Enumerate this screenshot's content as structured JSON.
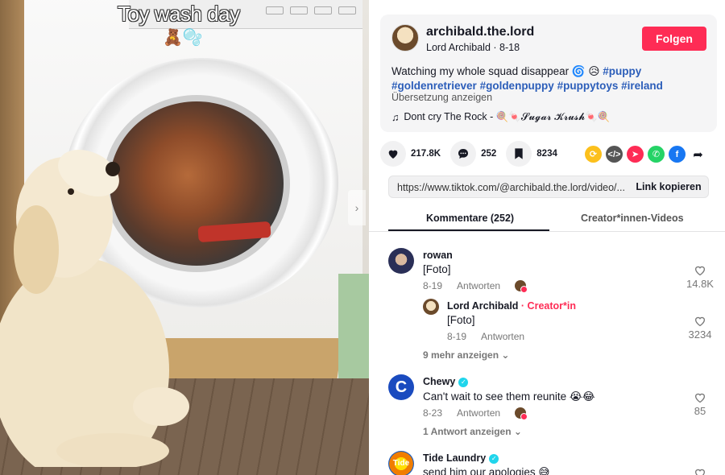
{
  "video": {
    "caption": "Toy wash day",
    "caption_emoji": "🧸🫧"
  },
  "post": {
    "username": "archibald.the.lord",
    "nickname_date": "Lord Archibald · 8-18",
    "follow_label": "Folgen",
    "description_text": "Watching my whole squad disappear 🌀 😥",
    "hashtags": [
      "#puppy",
      "#goldenretriever",
      "#goldenpuppy",
      "#puppytoys",
      "#ireland"
    ],
    "translate_label": "Übersetzung anzeigen",
    "music": "Dont cry The Rock - 🍭🍬𝓢𝓾𝓰𝓪𝓻 𝓚𝓻𝓾𝓼𝓱🍬🍭"
  },
  "actions": {
    "likes": "217.8K",
    "comments": "252",
    "saves": "8234"
  },
  "share": {
    "link": "https://www.tiktok.com/@archibald.the.lord/video/...",
    "copy_label": "Link kopieren"
  },
  "tabs": {
    "comments": "Kommentare (252)",
    "creator_videos": "Creator*innen-Videos"
  },
  "comments": [
    {
      "name": "rowan",
      "text": "[Foto]",
      "date": "8-19",
      "reply_label": "Antworten",
      "likes": "14.8K",
      "reply": {
        "name": "Lord Archibald",
        "badge": "· Creator*in",
        "text": "[Foto]",
        "date": "8-19",
        "reply_label": "Antworten",
        "likes": "3234"
      },
      "more_label": "9 mehr anzeigen"
    },
    {
      "name": "Chewy",
      "text": "Can't wait to see them reunite 😭😂",
      "date": "8-23",
      "reply_label": "Antworten",
      "likes": "85",
      "more_label": "1 Antwort anzeigen"
    },
    {
      "name": "Tide Laundry",
      "text": "send him our apologies 😅"
    }
  ],
  "colors": {
    "accent": "#fe2c55",
    "hashtag": "#2b5db9",
    "verified": "#20d5ec"
  }
}
